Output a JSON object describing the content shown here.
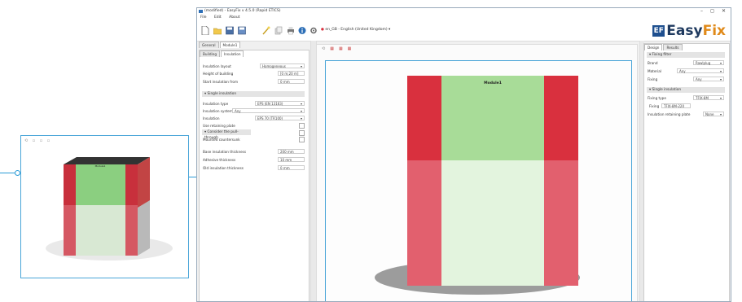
{
  "window": {
    "title": "(modified) - EasyFix v 4.5.0 (Rapid ETICS)",
    "controls": [
      "–",
      "◻",
      "✕"
    ]
  },
  "menu": [
    "File",
    "Edit",
    "About"
  ],
  "toolbar": {
    "language": "en_GB - English (United Kingdom)"
  },
  "brand": {
    "logo_letters": "EF",
    "name_a": "Easy",
    "name_b": "Fix"
  },
  "outer_tabs": [
    "General",
    "Module1"
  ],
  "inner_tabs": [
    "Building",
    "Insulation"
  ],
  "left_panel": {
    "insulation_layout_label": "Insulation layout",
    "insulation_layout_value": "Homogeneous",
    "height_label": "Height of building",
    "height_value": "[0 m;20 m]",
    "start_label": "Start insulation from",
    "start_value": "0 mm",
    "single_section": "Single insulation",
    "type_label": "Insulation type",
    "type_value": "EPS (EN 13163)",
    "system_label": "Insulation system",
    "system_value": "Any",
    "insulation_label": "Insulation",
    "insulation_value": "EPS 70 (TR100)",
    "retaining_label": "Use retaining plate",
    "consider_label": "Consider the pull-through",
    "mounted_label": "Mounted countersunk",
    "base_label": "Base insulation thickness",
    "base_value": "200 mm",
    "adhesive_label": "Adhesive thickness",
    "adhesive_value": "10 mm",
    "old_label": "Old insulation thickness",
    "old_value": "0 mm"
  },
  "viewport": {
    "model_label": "Module1",
    "toolbar_icons": [
      "rotate-icon",
      "view-front-icon",
      "view-side-icon",
      "view-top-icon"
    ]
  },
  "right_tabs": [
    "Design",
    "Results"
  ],
  "right_panel": {
    "section_title": "Fixing filter",
    "brand_label": "Brand",
    "brand_value": "Rawlplug",
    "material_label": "Material",
    "material_value": "Any",
    "fixing_label": "Fixing",
    "fixing_value": "Any",
    "single_section": "Single insulation",
    "fixing_type_label": "Fixing type",
    "fixing_type_value": "TFIX-8M",
    "fixing_item_label": "Fixing",
    "fixing_item_value": "TFIX-8M-220",
    "plate_label": "Insulation retaining plate",
    "plate_value": "None"
  },
  "colors": {
    "red": "#d9303e",
    "red_light": "#e2606e",
    "green": "#a8dc98",
    "green_light": "#e3f4de",
    "accent": "#2a9bd6",
    "shadow": "#9c9c9c"
  }
}
